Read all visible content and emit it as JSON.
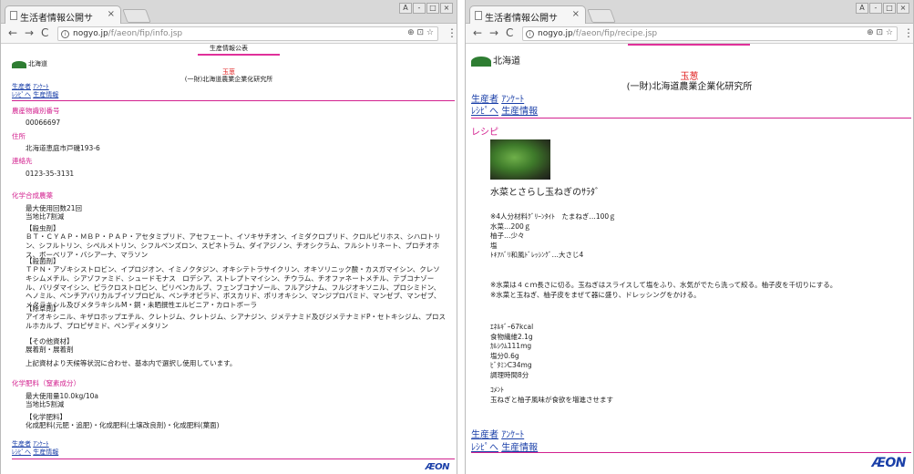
{
  "browser": {
    "tab_title": "生活者情報公開サ",
    "tab_close": "×",
    "url_host": "nogyo.jp",
    "left_url_path": "/f/aeon/fip/info.jsp",
    "right_url_path": "/f/aeon/fip/recipe.jsp",
    "zoom_icons": "⊕ ⊡ ☆",
    "menu_icon": "⋮",
    "back": "←",
    "forward": "→",
    "reload": "C",
    "info_glyph": "i",
    "win_min": "-",
    "win_max": "□",
    "win_close": "×",
    "win_user": "A"
  },
  "left": {
    "page_title": "生産情報公表",
    "logo_text": "北海道",
    "product": "玉葱",
    "org": "(一財)北海道農業企業化研究所",
    "links": {
      "producer": "生産者",
      "survey": "ｱﾝｹｰﾄ",
      "recipe": "ﾚｼﾋﾟへ",
      "production_info": "生産情報"
    },
    "id_label": "農産物識別番号",
    "id_value": "00066697",
    "address_label": "住所",
    "address_value": "北海道恵庭市戸磯193-6",
    "contact_label": "連絡先",
    "contact_value": "0123-35-3131",
    "pesticide_label": "化学合成農薬",
    "pesticide_count": "最大使用回数21回",
    "pesticide_standard": "当地比7割減",
    "insecticide_head": "【殺虫剤】",
    "insecticide_list": "ＢＴ・ＣＹＡＰ・ＭＢＰ・ＰＡＰ・アセタミプリド、アセフェート、イソキサチオン、イミダクロプリド、クロルピリホス、シハロトリン、シフルトリン、シペルメトリン、シフルベンズロン、スピネトラム、ダイアジノン、チオシクラム、フルシトリネート、プロチオホス、ボーベリア・バシアーナ、マラソン",
    "fungicide_head": "【殺菌剤】",
    "fungicide_list": "ＴＰＮ・アゾキシストロビン、イプロジオン、イミノクタジン、オキシテトラサイクリン、オキソリニック酸・カスガマイシン、クレソキシムメチル、シアゾファミド、シュードモナス　ロデシア、ストレプトマイシン、チウラム、チオファネートメチル、テブコナゾール、バリダマイシン、ピラクロストロビン、ピリベンカルブ、フェンブコナゾール、フルアジナム、フルジオキソニル、プロシミドン、ヘノミル、ベンチアバリカルブイソプロピル、ベンチオピラド、ボスカリド、ポリオキシン、マンジプロパミド、マンゼブ、マンゼブ、メタラキシル及びメタラキシルM・銅・未晒撰性エルビニア・カロトボーラ",
    "herbicide_head": "【除草剤】",
    "herbicide_list": "アイオキシニル、キザロホップエチル、クレトジム、クレトジム、シアナジン、ジメテナミド及びジメテナミドP・セトキシジム、プロスルホカルブ、プロピザミド、ペンディメタリン",
    "other_head": "【その他資材】",
    "other_list": "展着剤・展着剤",
    "other_note": "上記資材より天候等状況に合わせ、基本内で選択し使用しています。",
    "fert_label": "化学肥料（窒素成分）",
    "fert_amount": "最大使用量10.0kg/10a",
    "fert_standard": "当地比5割減",
    "fert_head": "【化学肥料】",
    "fert_list": "化成肥料(元肥・追肥)・化成肥料(土壌改良剤)・化成肥料(葉面)",
    "footer_logo": "ÆON"
  },
  "right": {
    "logo_text": "北海道",
    "product": "玉葱",
    "org": "(一財)北海道農業企業化研究所",
    "links": {
      "producer": "生産者",
      "survey": "ｱﾝｹｰﾄ",
      "recipe": "ﾚｼﾋﾟへ",
      "production_info": "生産情報"
    },
    "section_label": "レシピ",
    "recipe_title": "水菜とさらし玉ねぎのｻﾗﾀﾞ",
    "ingredients": [
      "※4人分材料ｸﾞﾘｰﾝﾀｲﾄ　たまねぎ…100ｇ",
      "水菜…200ｇ",
      "柚子…少々",
      "塩",
      "ﾄｷｱﾊﾞﾘ和風ﾄﾞﾚｯｼﾝｸﾞ…大さじ4"
    ],
    "steps": [
      "※水菜は４ｃｍ長さに切る。玉ねぎはスライスして塩をふり、水気がでたら洗って絞る。柚子皮を千切りにする。",
      "※水菜と玉ねぎ、柚子皮をまぜて器に盛り、ドレッシングをかける。"
    ],
    "nutrition": [
      "ｴﾈﾙｷﾞｰ67kcal",
      "食物繊維2.1g",
      "ｶﾙｼｳﾑ111mg",
      "塩分0.6g",
      "ﾋﾞﾀﾐﾝC34mg",
      "調理時間8分"
    ],
    "comment_head": "ｺﾒﾝﾄ",
    "comment": "玉ねぎと柚子風味が食欲を増進させます",
    "footer_logo": "ÆON"
  },
  "colors": {
    "accent": "#d3218f",
    "link": "#1a3fa8",
    "product": "#e02020"
  }
}
